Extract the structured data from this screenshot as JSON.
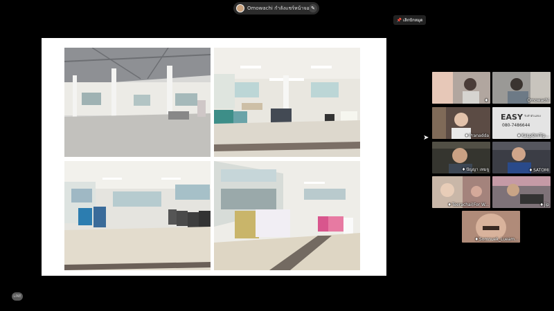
{
  "top_bar": {
    "presenter_status": "Omowachi กำลังแชร์หน้าจอ",
    "edit_icon": "pencil-icon"
  },
  "stop_share": {
    "label": "เลิกปักหมุด",
    "icon": "pin-icon"
  },
  "slide": {
    "photos": [
      {
        "name": "photo-open-hall"
      },
      {
        "name": "photo-laundry-room"
      },
      {
        "name": "photo-washer-room"
      },
      {
        "name": "photo-clothing-room"
      }
    ]
  },
  "participants": [
    {
      "label": "",
      "color": "#9a8f86"
    },
    {
      "label": "Omowachi",
      "color": "#8b8a86"
    },
    {
      "label": "Pranadda",
      "color": "#5b4b44"
    },
    {
      "label": "KaLpOmTip...",
      "color": "#d9d9d9",
      "poster_title": "EASY",
      "poster_subtitle": "รับทำตัวแสดง",
      "poster_phone": "080-7486644"
    },
    {
      "label": "ปัญญา เหมจู",
      "color": "#35352f"
    },
    {
      "label": "SATOMI",
      "color": "#3b3d45"
    },
    {
      "label": "Teerachai(For W...",
      "color": "#c9b7a8"
    },
    {
      "label": "jip",
      "color": "#7e7278"
    },
    {
      "label": "Somnuek_Lueam...",
      "color": "#b08b79"
    }
  ],
  "app_logo": "LINE"
}
